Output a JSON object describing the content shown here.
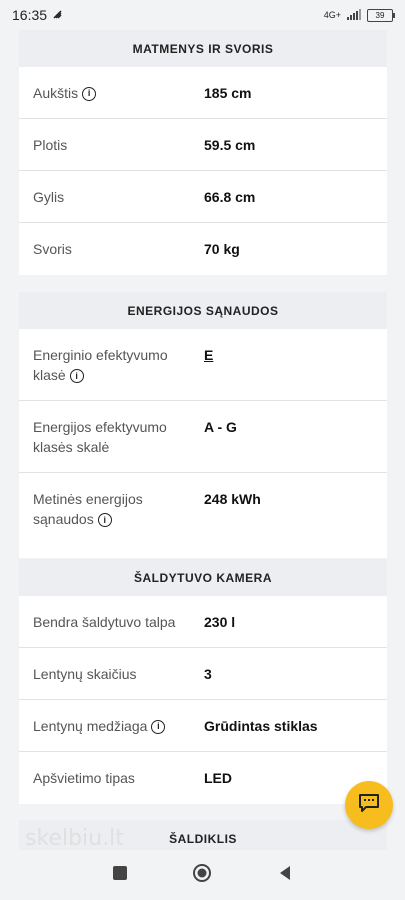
{
  "status": {
    "time": "16:35",
    "network": "4G+",
    "battery": "39"
  },
  "sections": {
    "dimensions": {
      "title": "MATMENYS IR SVORIS",
      "rows": [
        {
          "label": "Aukštis",
          "value": "185 cm"
        },
        {
          "label": "Plotis",
          "value": "59.5 cm"
        },
        {
          "label": "Gylis",
          "value": "66.8 cm"
        },
        {
          "label": "Svoris",
          "value": "70 kg"
        }
      ]
    },
    "energy": {
      "title": "ENERGIJOS SĄNAUDOS",
      "rows": [
        {
          "label_l1": "Energinio efektyvumo",
          "label_l2": "klasė",
          "value": "E"
        },
        {
          "label_l1": "Energijos efektyvumo",
          "label_l2": "klasės skalė",
          "value": "A - G"
        },
        {
          "label_l1": "Metinės energijos",
          "label_l2": "sąnaudos",
          "value": "248 kWh"
        }
      ]
    },
    "fridge": {
      "title": "ŠALDYTUVO KAMERA",
      "rows": [
        {
          "label": "Bendra šaldytuvo talpa",
          "value": "230 l"
        },
        {
          "label": "Lentynų skaičius",
          "value": "3"
        },
        {
          "label": "Lentynų medžiaga",
          "value": "Grūdintas stiklas"
        },
        {
          "label": "Apšvietimo tipas",
          "value": "LED"
        }
      ]
    },
    "freezer": {
      "title": "ŠALDIKLIS"
    }
  },
  "watermark": "skelbiu.lt",
  "colors": {
    "chat_button": "#f7bd1e",
    "section_bg": "#eceef1"
  }
}
